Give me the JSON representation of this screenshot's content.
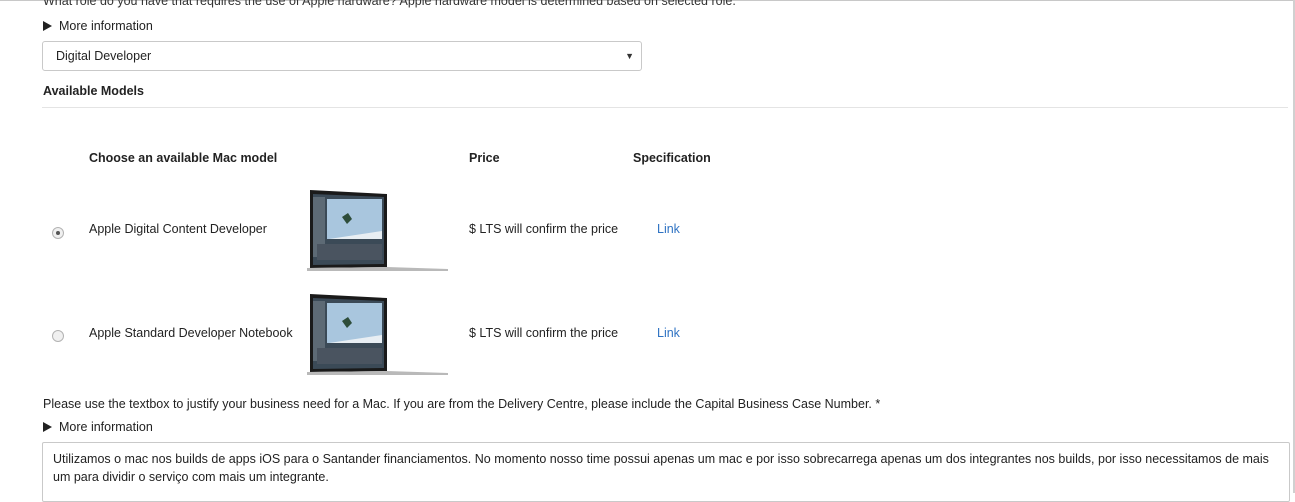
{
  "question": {
    "text": "What role do you have that requires the use of Apple hardware? Apple hardware model is determined based on selected role.",
    "more_info_label": "More information"
  },
  "role_select": {
    "value": "Digital Developer"
  },
  "available_models": {
    "title": "Available Models",
    "headers": {
      "model": "Choose an available Mac model",
      "price": "Price",
      "spec": "Specification"
    },
    "rows": [
      {
        "name": "Apple Digital Content Developer",
        "price": "$ LTS will confirm the price",
        "link": "Link",
        "selected": true
      },
      {
        "name": "Apple Standard Developer Notebook",
        "price": "$ LTS will confirm the price",
        "link": "Link",
        "selected": false
      }
    ]
  },
  "justification": {
    "label": "Please use the textbox to justify your business need for a Mac. If you are from the Delivery Centre, please include the Capital Business Case Number. *",
    "more_info_label": "More information",
    "value": "Utilizamos o mac nos builds de apps iOS para o Santander financiamentos. No momento nosso time possui apenas um mac e por isso sobrecarrega apenas um dos integrantes nos builds, por isso necessitamos de mais um para dividir o serviço com mais um integrante."
  },
  "colors": {
    "link": "#2f73c3",
    "border": "#c9c9c9"
  }
}
